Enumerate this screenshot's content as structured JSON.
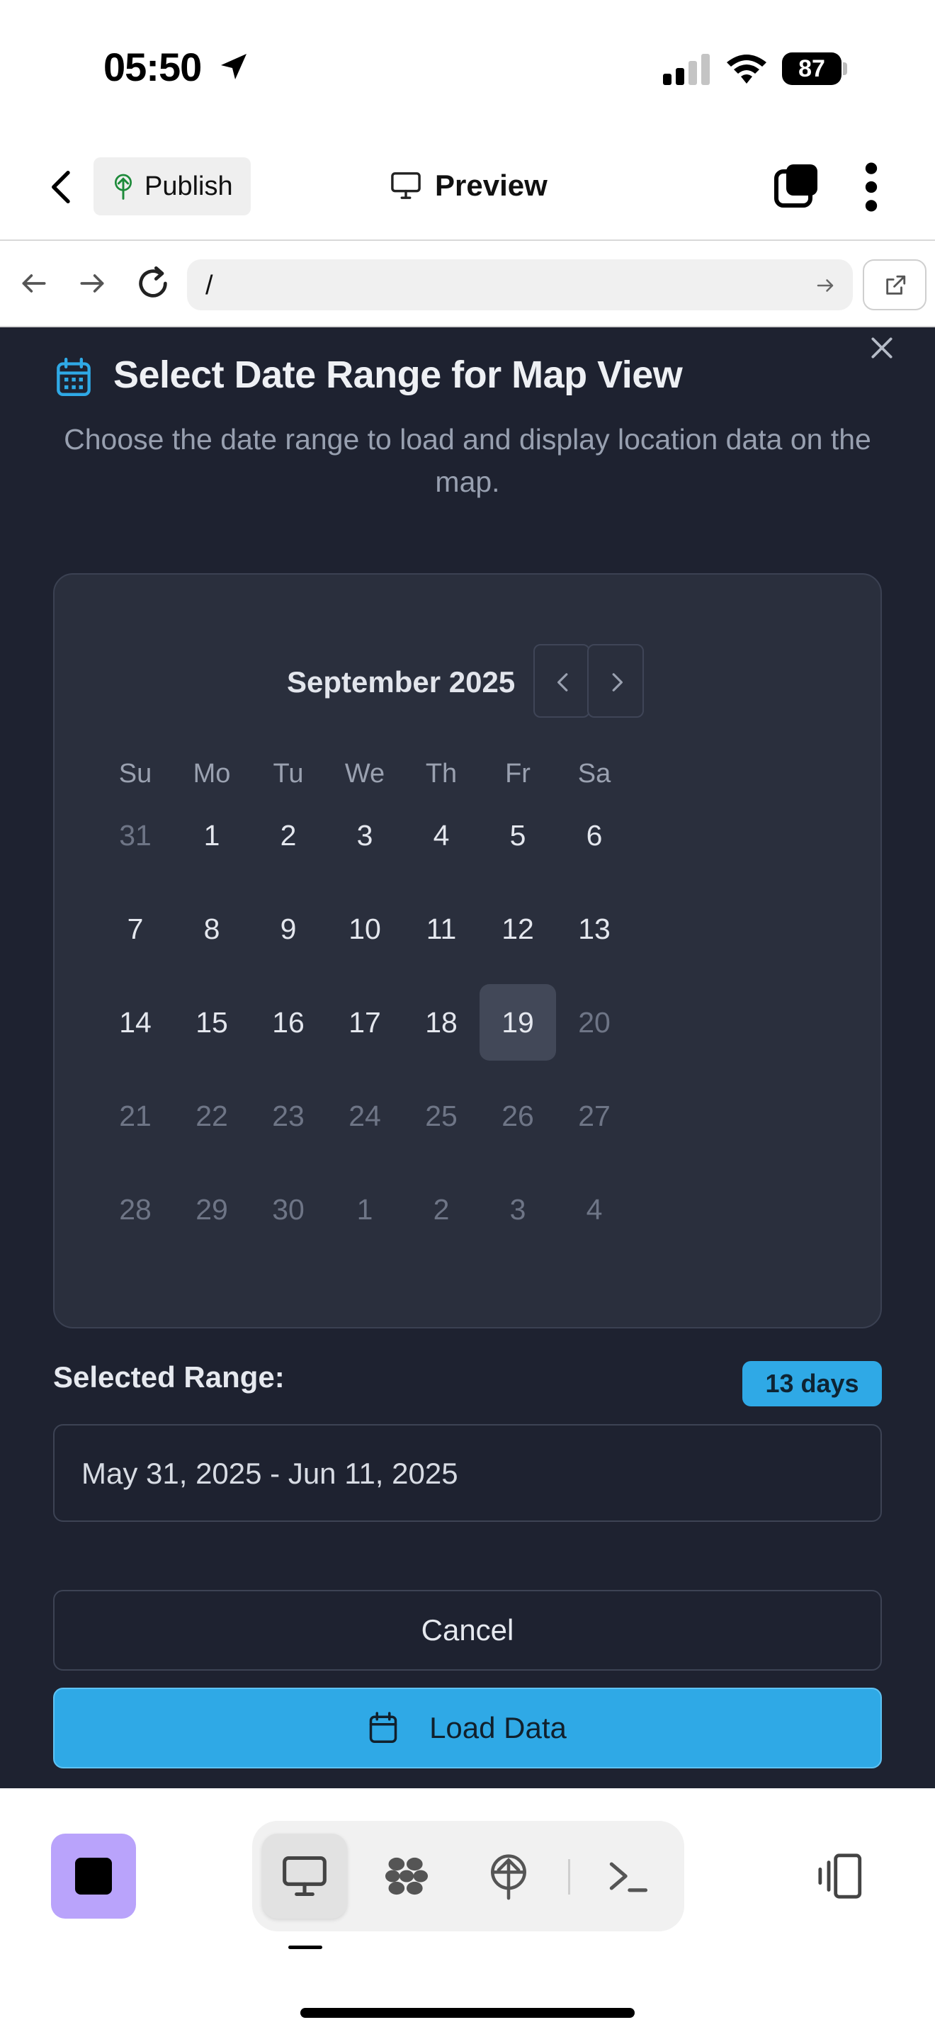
{
  "status_bar": {
    "time": "05:50",
    "battery": "87"
  },
  "header": {
    "publish_label": "Publish",
    "preview_label": "Preview"
  },
  "url_bar": {
    "url": "/"
  },
  "dialog": {
    "title": "Select Date Range for Map View",
    "description": "Choose the date range to load and display location data on the map.",
    "calendar": {
      "month_label": "September 2025",
      "weekdays": [
        "Su",
        "Mo",
        "Tu",
        "We",
        "Th",
        "Fr",
        "Sa"
      ],
      "weeks": [
        [
          "31",
          "1",
          "2",
          "3",
          "4",
          "5",
          "6"
        ],
        [
          "7",
          "8",
          "9",
          "10",
          "11",
          "12",
          "13"
        ],
        [
          "14",
          "15",
          "16",
          "17",
          "18",
          "19",
          "20"
        ],
        [
          "21",
          "22",
          "23",
          "24",
          "25",
          "26",
          "27"
        ],
        [
          "28",
          "29",
          "30",
          "1",
          "2",
          "3",
          "4"
        ]
      ],
      "today": "19"
    },
    "selected_range_label": "Selected Range:",
    "days_badge": "13 days",
    "range_value": "May 31, 2025 - Jun 11, 2025",
    "cancel_label": "Cancel",
    "load_label": "Load Data"
  },
  "colors": {
    "accent": "#2fa9e6",
    "dialog_bg": "#1e2230",
    "card_bg": "#2a2f3d",
    "stop_button": "#b9a3fb"
  }
}
